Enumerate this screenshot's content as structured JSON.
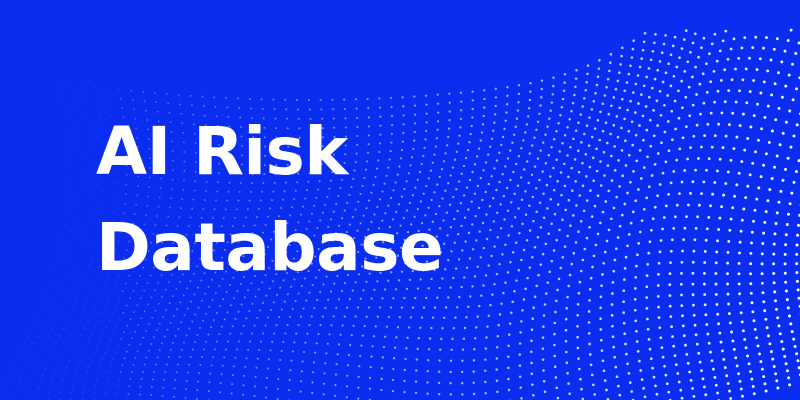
{
  "banner": {
    "title_line1": "AI Risk",
    "title_line2": "Database",
    "background_color": "#0a2df0",
    "dot_color": "#ffffff",
    "decoration": "dot-wave-pattern"
  }
}
